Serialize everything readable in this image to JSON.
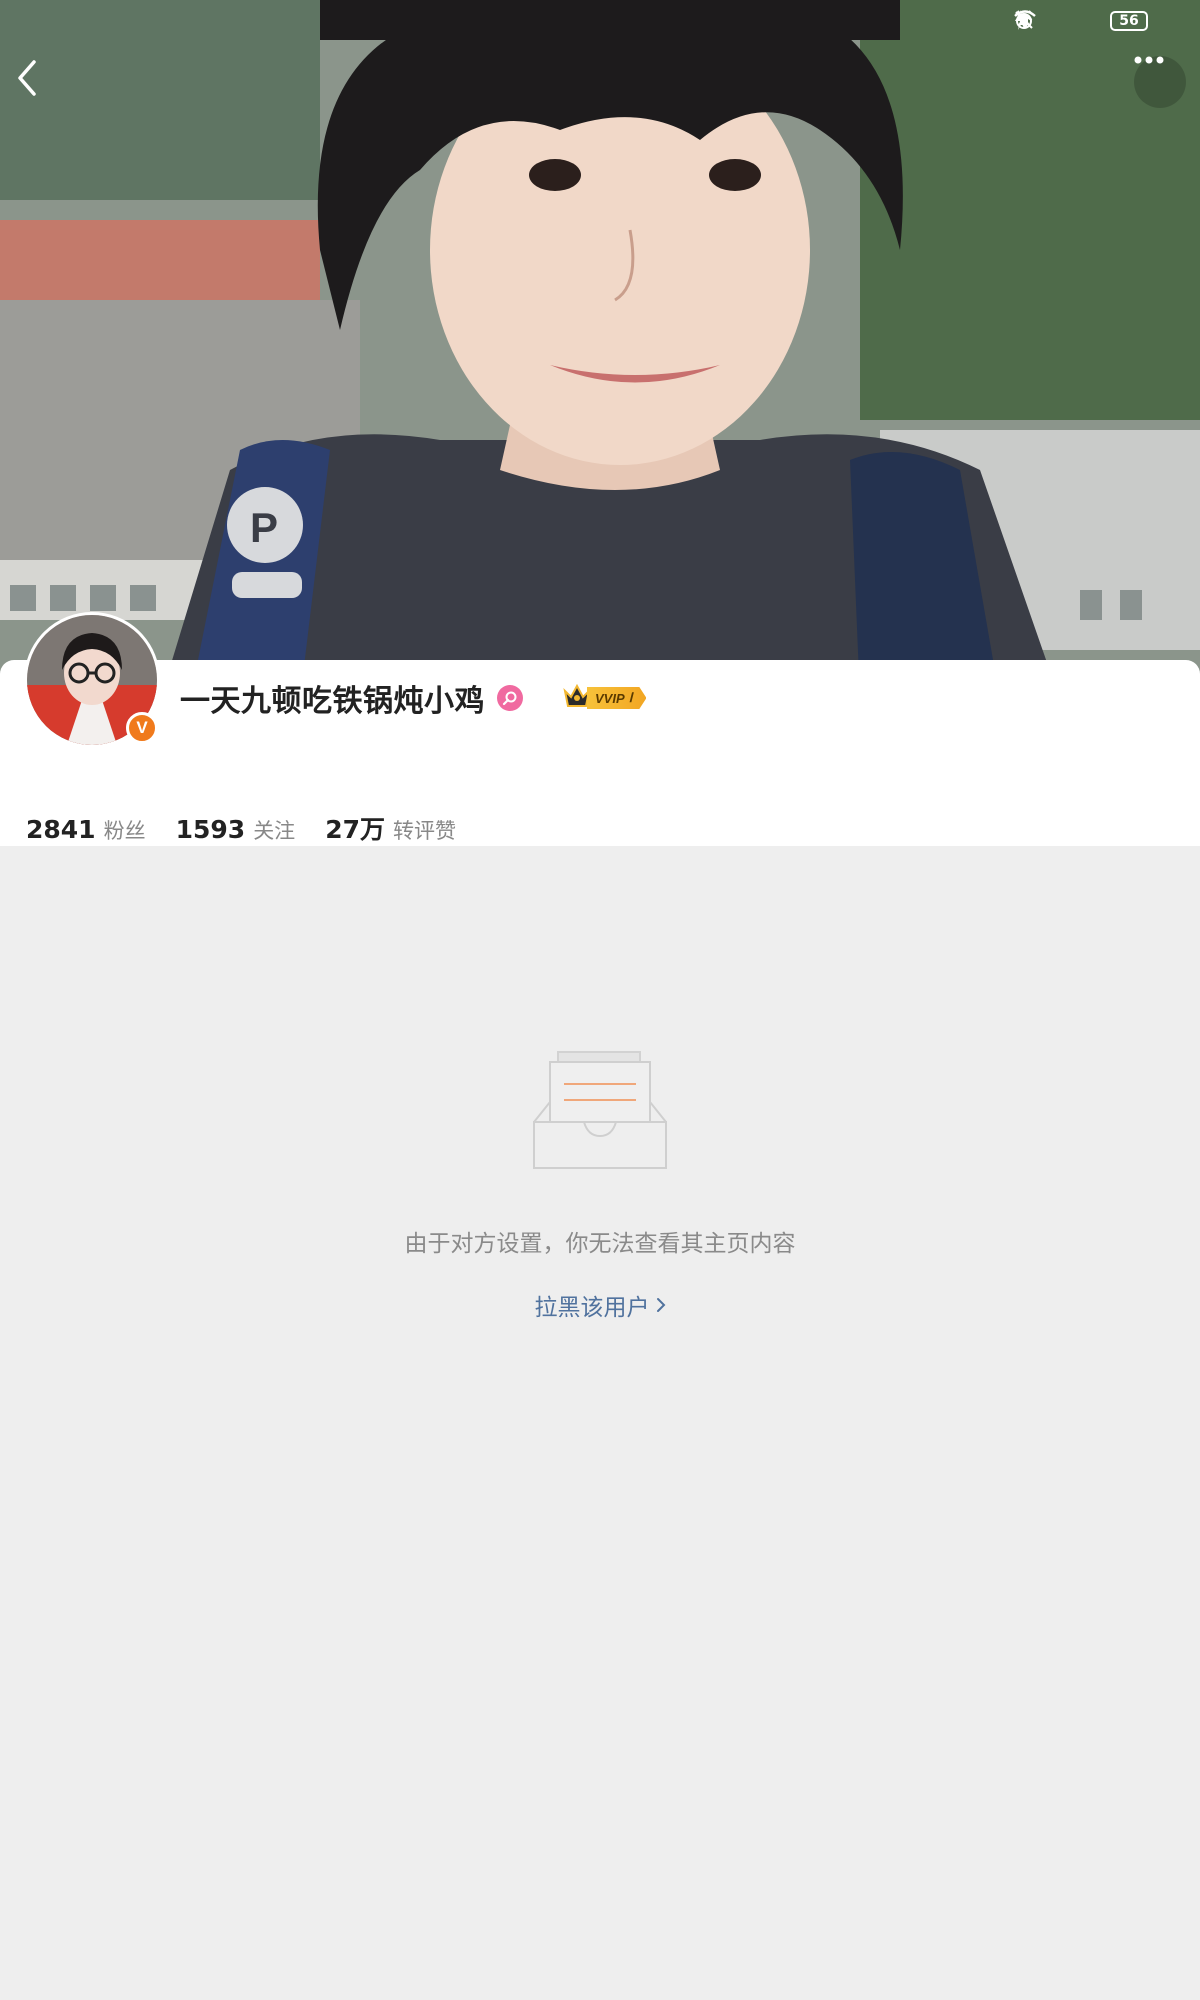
{
  "status_bar": {
    "battery": "56",
    "icons": [
      "alarm-icon",
      "mute-bell-icon",
      "wifi-icon",
      "charging-icon"
    ]
  },
  "nav": {
    "back_icon": "chevron-left-icon",
    "more_icon": "more-dots-icon"
  },
  "profile": {
    "username": "一天九顿吃铁锅炖小鸡",
    "verified_badge": "V",
    "vip_label": "VVIP",
    "vip_level": "Ⅰ",
    "accent_color": "#f07a1c"
  },
  "stats": [
    {
      "value": "2841",
      "label": "粉丝"
    },
    {
      "value": "1593",
      "label": "关注"
    },
    {
      "value": "27万",
      "label": "转评赞"
    }
  ],
  "empty_state": {
    "message": "由于对方设置，你无法查看其主页内容",
    "action": "拉黑该用户",
    "action_color": "#50729e"
  }
}
